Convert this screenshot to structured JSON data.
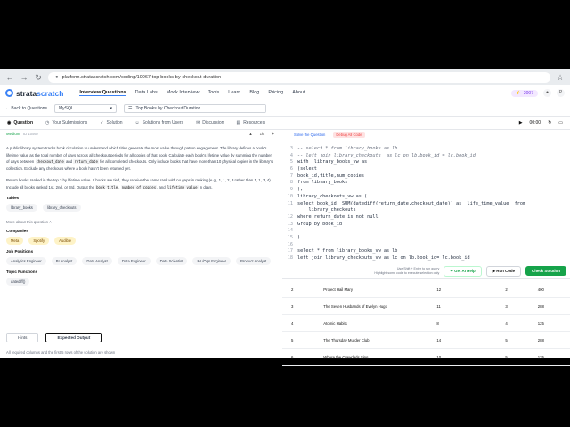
{
  "browser": {
    "url": "platform.stratascratch.com/coding/10067-top-books-by-checkout-duration"
  },
  "appbar": {
    "logo_text": "strata",
    "logo_accent": "scratch",
    "nav": [
      "Interview Questions",
      "Data Labs",
      "Mock Interview",
      "Tools",
      "Learn",
      "Blog",
      "Pricing",
      "About"
    ],
    "pro_label": "2007",
    "avatar": "P"
  },
  "probbar": {
    "back": "Back to Questions",
    "dialect": "MySQL",
    "title": "Top Books by Checkout Duration"
  },
  "tabs": [
    "Question",
    "Your Submissions",
    "Solution",
    "Solutions from Users",
    "Discussion",
    "Resources"
  ],
  "timer": "00:00",
  "question": {
    "difficulty": "Medium",
    "id": "ID 10567",
    "likes": "1k",
    "p1a": "A public library system tracks book circulation to understand which titles generate the most value through patron engagement. The library defines a book's lifetime value as the total number of days across all checkout periods for all copies of that book. Calculate each book's lifetime value by summing the number of days between ",
    "p1_code1": "checkout_date",
    "p1_mid": " and ",
    "p1_code2": "return_date",
    "p1b": " for all completed checkouts. Only include books that have more than 10 physical copies in the library's collection. Exclude any checkouts where a book hasn't been returned yet.",
    "p2a": "Return books ranked in the top 3 by lifetime value. If books are tied, they receive the same rank with no gaps in ranking (e.g., 1, 1, 2, 3 rather than 1, 1, 3, 4). Include all books ranked 1st, 2nd, or 3rd. Output the ",
    "p2_code1": "book_title",
    "p2_sep1": ", ",
    "p2_code2": "number_of_copies",
    "p2_sep2": ", and ",
    "p2_code3": "lifetime_value",
    "p2b": " in days.",
    "tables_label": "Tables",
    "tables": [
      "library_books",
      "library_checkouts"
    ],
    "more_label": "More about this question",
    "companies_label": "Companies",
    "companies": [
      "Meta",
      "Spotify",
      "Audible"
    ],
    "positions_label": "Job Positions",
    "positions": [
      "Analytics Engineer",
      "BI Analyst",
      "Data Analyst",
      "Data Engineer",
      "Data Scientist",
      "ML/Ops Engineer",
      "Product Analyst"
    ],
    "functions_label": "Topic Functions",
    "functions": [
      "datediff()"
    ],
    "bottom_tabs": [
      "Hints",
      "Expected Output"
    ],
    "bottom_note": "All required columns and the first 5 rows of the solution are shown"
  },
  "editor": {
    "btn_schema": "Solve the Question",
    "btn_debug": "Debug All Code",
    "lines": [
      {
        "n": "3",
        "t": "-- select * from library_books as lb",
        "c": true
      },
      {
        "n": "4",
        "t": "-- left join library_checkouts  as lc on lb.book_id = lc.book_id",
        "c": true
      },
      {
        "n": "5",
        "t": "with  library_books_vw as",
        "c": false
      },
      {
        "n": "6",
        "t": "(select",
        "c": false
      },
      {
        "n": "7",
        "t": "book_id,title,num_copies",
        "c": false
      },
      {
        "n": "8",
        "t": "from library_books",
        "c": false
      },
      {
        "n": "9",
        "t": "),",
        "c": false
      },
      {
        "n": "10",
        "t": "library_checkouts_vw as (",
        "c": false
      },
      {
        "n": "11",
        "t": "select book_id, SUM(datediff(return_date,checkout_date)) as  life_time_value  from",
        "c": false
      },
      {
        "n": "",
        "t": "    library_checkouts",
        "c": false
      },
      {
        "n": "12",
        "t": "where return_date is not null",
        "c": false
      },
      {
        "n": "13",
        "t": "Group by book_id",
        "c": false
      },
      {
        "n": "14",
        "t": "",
        "c": false
      },
      {
        "n": "15",
        "t": ")",
        "c": false
      },
      {
        "n": "16",
        "t": "",
        "c": false
      },
      {
        "n": "17",
        "t": "select * from library_books_vw as lb",
        "c": false
      },
      {
        "n": "18",
        "t": "left join library_checkouts_vw as lc on lb.book_id= lc.book_id",
        "c": false
      }
    ],
    "hint_line1": "Use Shift + Enter to run query",
    "hint_line2": "Highlight some code to execute selection only",
    "ai_label": "Get AI Help",
    "run_label": "Run Code",
    "check_label": "Check Solution"
  },
  "results": [
    [
      "2",
      "Project Hail Mary",
      "12",
      "2",
      "400"
    ],
    [
      "3",
      "The Seven Husbands of Evelyn Hugo",
      "11",
      "3",
      "288"
    ],
    [
      "4",
      "Atomic Habits",
      "8",
      "4",
      "125"
    ],
    [
      "5",
      "The Thursday Murder Club",
      "14",
      "5",
      "288"
    ],
    [
      "6",
      "Where the Crawdads Sing",
      "10",
      "5",
      "125"
    ]
  ]
}
